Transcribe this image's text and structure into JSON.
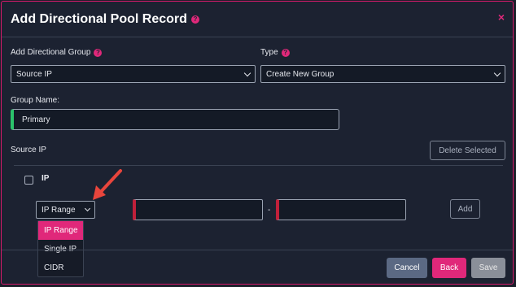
{
  "modal": {
    "title": "Add Directional Pool Record",
    "close_label": "×"
  },
  "form": {
    "group_label": "Add Directional Group",
    "group_value": "Source IP",
    "type_label": "Type",
    "type_value": "Create New Group",
    "group_name_label": "Group Name:",
    "group_name_value": "Primary"
  },
  "source_ip": {
    "heading": "Source IP",
    "delete_label": "Delete Selected",
    "column_ip": "IP",
    "range_select_value": "IP Range",
    "range_separator": "-",
    "add_label": "Add",
    "dropdown_options": [
      "IP Range",
      "Single IP",
      "CIDR"
    ],
    "dropdown_selected": "IP Range"
  },
  "footer": {
    "cancel_label": "Cancel",
    "back_label": "Back",
    "save_label": "Save"
  },
  "colors": {
    "accent": "#e0287a",
    "panel": "#1c2231",
    "success_border": "#2bc26b",
    "error_border": "#c0203a",
    "cancel_button": "#5b6983",
    "save_button_disabled": "#8a8f99",
    "annotation_arrow": "#e8453c"
  },
  "icons": {
    "help": "question-circle-icon",
    "dropdown_indicator": "chevron-down-icon",
    "close": "close-icon",
    "pointer": "red-arrow-annotation"
  }
}
